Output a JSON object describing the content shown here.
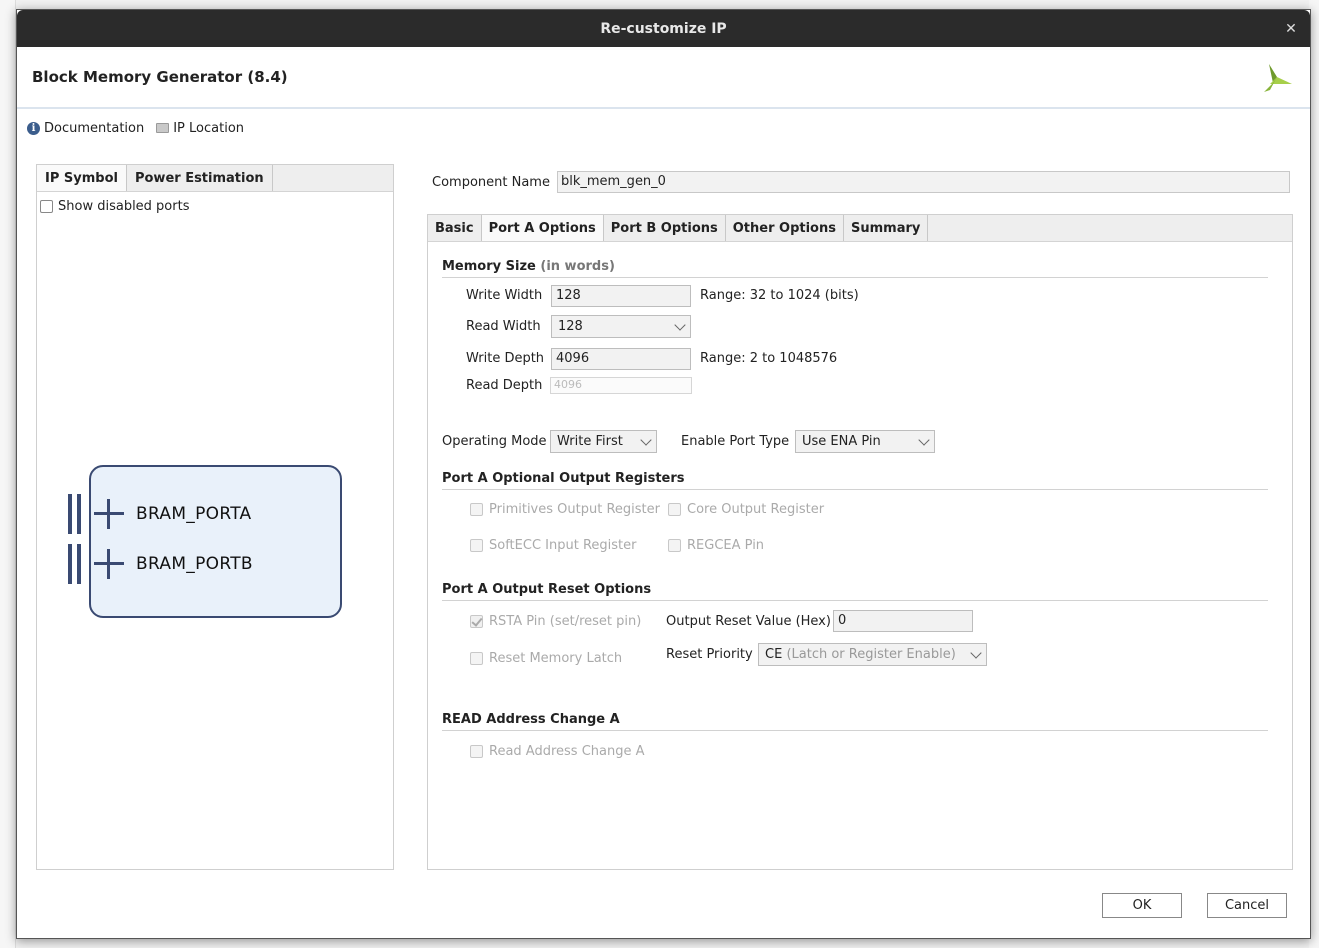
{
  "window": {
    "title": "Re-customize IP",
    "close_glyph": "✕"
  },
  "header": {
    "title": "Block Memory Generator (8.4)",
    "logo_icon": "xilinx-logo-icon"
  },
  "links": {
    "documentation": "Documentation",
    "ip_location": "IP Location"
  },
  "left": {
    "tabs": [
      "IP Symbol",
      "Power Estimation"
    ],
    "active_tab": "IP Symbol",
    "show_disabled_label": "Show disabled ports",
    "show_disabled_checked": false,
    "ports": [
      "BRAM_PORTA",
      "BRAM_PORTB"
    ]
  },
  "component": {
    "label": "Component Name",
    "value": "blk_mem_gen_0"
  },
  "tabs": [
    "Basic",
    "Port A Options",
    "Port B Options",
    "Other Options",
    "Summary"
  ],
  "active_tab": "Port A Options",
  "memory_size": {
    "title": "Memory Size",
    "subtitle": "(in words)",
    "write_width_label": "Write Width",
    "write_width": "128",
    "write_width_range": "Range: 32 to 1024 (bits)",
    "read_width_label": "Read Width",
    "read_width": "128",
    "write_depth_label": "Write Depth",
    "write_depth": "4096",
    "write_depth_range": "Range: 2 to 1048576",
    "read_depth_label": "Read Depth",
    "read_depth": "4096"
  },
  "mode": {
    "operating_mode_label": "Operating Mode",
    "operating_mode": "Write First",
    "enable_port_label": "Enable Port Type",
    "enable_port": "Use ENA Pin"
  },
  "optional_regs": {
    "title": "Port A Optional Output Registers",
    "primitives": "Primitives Output Register",
    "core": "Core Output Register",
    "softecc": "SoftECC Input Register",
    "regcea": "REGCEA Pin"
  },
  "reset": {
    "title": "Port A Output Reset Options",
    "rsta": "RSTA Pin (set/reset pin)",
    "output_reset_label": "Output Reset Value (Hex)",
    "output_reset_value": "0",
    "reset_memory_latch": "Reset Memory Latch",
    "reset_priority_label": "Reset Priority",
    "reset_priority_main": "CE",
    "reset_priority_sub": "(Latch or Register Enable)"
  },
  "read_addr": {
    "title": "READ Address Change A",
    "option": "Read Address Change A"
  },
  "buttons": {
    "ok": "OK",
    "cancel": "Cancel"
  }
}
